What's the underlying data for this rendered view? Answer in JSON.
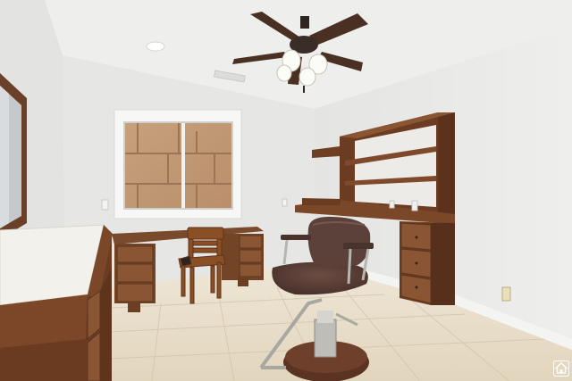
{
  "scene": {
    "description_colors": {
      "ceiling": "#ededeb",
      "left_wall": "#e4e4e2",
      "back_wall": "#e7e7e5",
      "right_wall": "#ebebe9",
      "floor_tile": "#e3d8c4",
      "wood": "#6e3f24",
      "wood_light": "#8a5330",
      "countertop": "#f3f1ec",
      "chair_leather": "#5a4038",
      "window_brick": "#c9a27f"
    },
    "watermark_icon": "house-icon"
  }
}
